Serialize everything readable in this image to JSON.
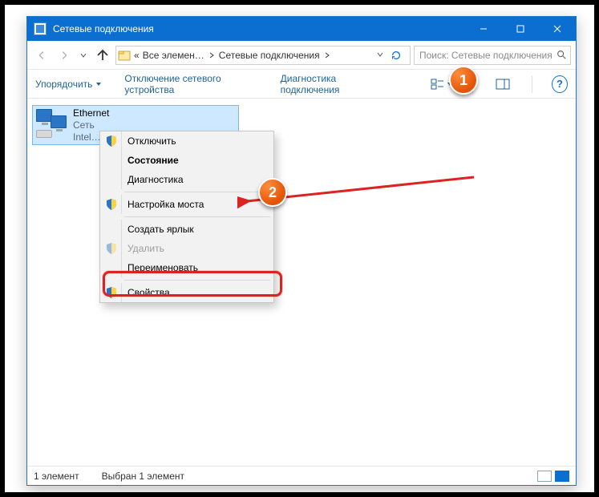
{
  "titlebar": {
    "title": "Сетевые подключения"
  },
  "nav": {
    "crumb_prefix": "«",
    "crumb1": "Все элемен…",
    "crumb2": "Сетевые подключения"
  },
  "search": {
    "placeholder": "Поиск: Сетевые подключения"
  },
  "toolbar": {
    "organize": "Упорядочить",
    "disable_device": "Отключение сетевого устройства",
    "diagnose": "Диагностика подключения",
    "help": "?"
  },
  "adapter": {
    "name": "Ethernet",
    "network": "Сеть",
    "nic": "Intel…"
  },
  "ctx": {
    "disable": "Отключить",
    "status": "Состояние",
    "diag": "Диагностика",
    "bridge": "Настройка моста",
    "shortcut": "Создать ярлык",
    "delete": "Удалить",
    "rename": "Переименовать",
    "props": "Свойства"
  },
  "status": {
    "count": "1 элемент",
    "sel": "Выбран 1 элемент"
  },
  "callouts": {
    "one": "1",
    "two": "2"
  }
}
